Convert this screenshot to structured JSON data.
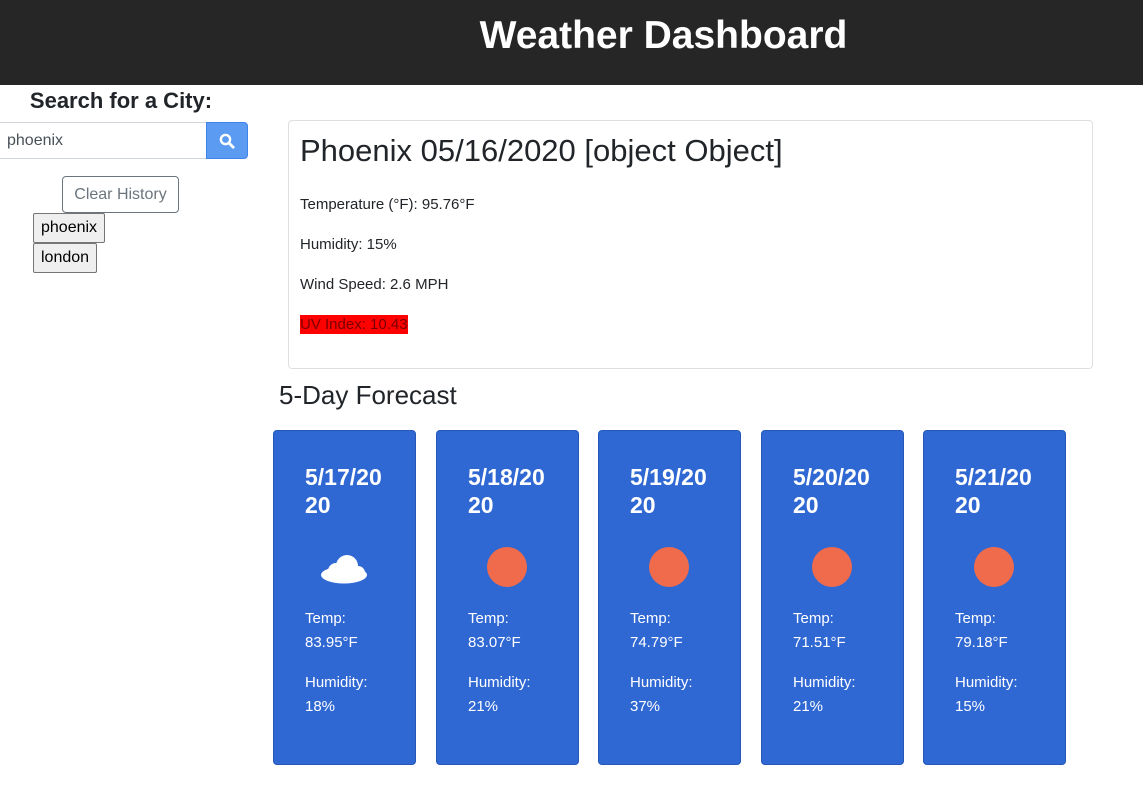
{
  "header": {
    "title": "Weather Dashboard"
  },
  "sidebar": {
    "heading": "Search for a City:",
    "search": {
      "value": "phoenix",
      "placeholder": ""
    },
    "clear_label": "Clear History",
    "history": [
      {
        "label": "phoenix"
      },
      {
        "label": "london"
      }
    ]
  },
  "current": {
    "title": "Phoenix 05/16/2020 [object Object]",
    "temperature": "Temperature (°F): 95.76°F",
    "humidity": "Humidity: 15%",
    "wind": "Wind Speed: 2.6 MPH",
    "uv": "UV Index: 10.43",
    "uv_color": "#ff0000"
  },
  "forecast": {
    "heading": "5-Day Forecast",
    "card_color": "#2f67d3",
    "days": [
      {
        "date": "5/17/2020",
        "icon": "cloud-icon",
        "temp_label": "Temp:",
        "temp": "83.95°F",
        "humidity_label": "Humidity:",
        "humidity": "18%"
      },
      {
        "date": "5/18/2020",
        "icon": "sun-icon",
        "temp_label": "Temp:",
        "temp": "83.07°F",
        "humidity_label": "Humidity:",
        "humidity": "21%"
      },
      {
        "date": "5/19/2020",
        "icon": "sun-icon",
        "temp_label": "Temp:",
        "temp": "74.79°F",
        "humidity_label": "Humidity:",
        "humidity": "37%"
      },
      {
        "date": "5/20/2020",
        "icon": "sun-icon",
        "temp_label": "Temp:",
        "temp": "71.51°F",
        "humidity_label": "Humidity:",
        "humidity": "21%"
      },
      {
        "date": "5/21/2020",
        "icon": "sun-icon",
        "temp_label": "Temp:",
        "temp": "79.18°F",
        "humidity_label": "Humidity:",
        "humidity": "15%"
      }
    ]
  }
}
